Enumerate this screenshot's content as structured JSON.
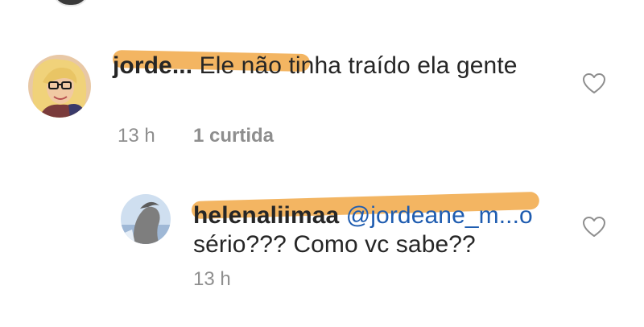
{
  "comments": [
    {
      "username": "jorde...",
      "text": " Ele não tinha traído ela gente",
      "time": "13 h",
      "likes": "1 curtida"
    },
    {
      "username": "helenaliimaa",
      "mention": "@jordeane_m...o",
      "text": " sério??? Como vc sabe??",
      "time": "13 h"
    }
  ],
  "icons": {
    "like": "heart-outline-icon"
  },
  "colors": {
    "scribble": "#f2b25c",
    "meta": "#8e8e8e",
    "text": "#262626",
    "mention": "#1e5cb0"
  }
}
